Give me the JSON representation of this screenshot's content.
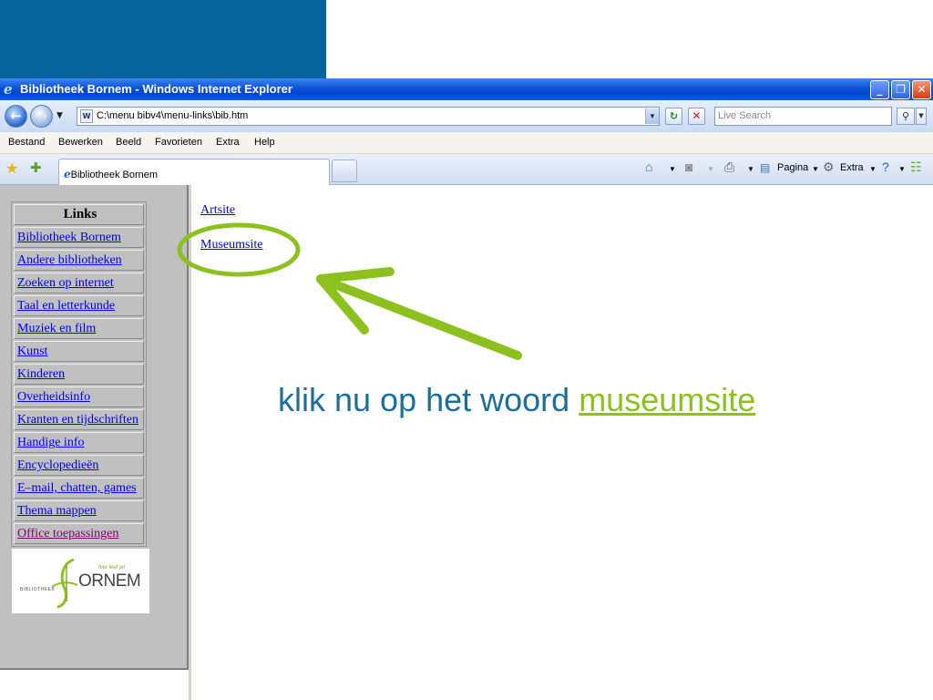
{
  "colors": {
    "slide_accent": "#08649a",
    "annotation_green": "#8cc11f",
    "instruction_blue": "#1a6f9b",
    "link_blue": "#0000ee",
    "link_visited": "#800080"
  },
  "window": {
    "title": "Bibliotheek Bornem - Windows Internet Explorer",
    "icon": "ie-logo-icon",
    "controls": {
      "minimize": "_",
      "maximize": "❐",
      "close": "✕"
    }
  },
  "address_bar": {
    "back_icon": "back-arrow-icon",
    "forward_icon": "forward-arrow-icon",
    "url": "C:\\menu bibv4\\menu-links\\bib.htm",
    "search_placeholder": "Live Search",
    "refresh_icon": "refresh-icon",
    "stop_icon": "stop-icon",
    "search_icon": "search-icon"
  },
  "menu": [
    "Bestand",
    "Bewerken",
    "Beeld",
    "Favorieten",
    "Extra",
    "Help"
  ],
  "tab": {
    "label": "Bibliotheek Bornem",
    "commands": {
      "page": "Pagina",
      "tools": "Extra"
    }
  },
  "sidebar": {
    "header": "Links",
    "items": [
      "Bibliotheek Bornem",
      "Andere bibliotheken",
      "Zoeken op internet",
      "Taal en letterkunde",
      "Muziek en film",
      "Kunst",
      "Kinderen",
      "Overheidsinfo",
      "Kranten en tijdschriften",
      "Handige info",
      "Encyclopedieën",
      "E–mail, chatten, games",
      "Thema mappen",
      "Office toepassingen"
    ],
    "logo": {
      "small_text": "BIBLIOTHEEK",
      "name": "ORNEM",
      "tagline": "hier leef je!"
    }
  },
  "content": {
    "links": [
      "Artsite",
      "Museumsite"
    ]
  },
  "instruction": {
    "prefix": "klik nu op het woord ",
    "highlight": "museumsite"
  }
}
